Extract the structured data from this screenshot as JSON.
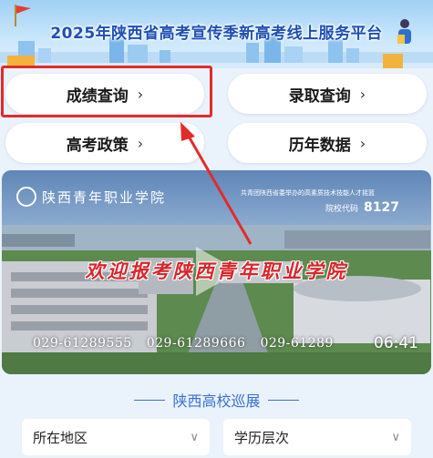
{
  "banner": {
    "title": "2025年陕西省高考宣传季新高考线上服务平台"
  },
  "nav": [
    {
      "label": "成绩查询",
      "arrow": "›",
      "highlighted": true
    },
    {
      "label": "录取查询",
      "arrow": "›"
    },
    {
      "label": "高考政策",
      "arrow": "›"
    },
    {
      "label": "历年数据",
      "arrow": "›"
    }
  ],
  "video": {
    "school_name": "陕西青年职业学院",
    "subtitle": "共青团陕西省委举办的高素质技术技能人才摇篮",
    "code_label": "院校代码",
    "code_value": "8127",
    "slogan": "欢迎报考陕西青年职业学院",
    "phones": [
      "029-61289555",
      "029-61289666",
      "029-61289"
    ],
    "duration": "06:41"
  },
  "section": {
    "title": "陕西高校巡展",
    "filters": [
      {
        "label": "所在地区",
        "chevron": "∨"
      },
      {
        "label": "学历层次",
        "chevron": "∨"
      }
    ]
  },
  "colors": {
    "accent": "#3b6fd6",
    "highlight_border": "#e22b2b",
    "slogan": "#d7262c",
    "banner_title": "#1f4fb4"
  }
}
